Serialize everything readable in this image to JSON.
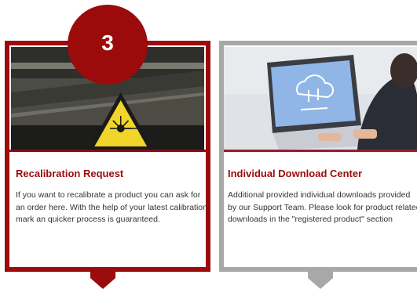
{
  "cards": [
    {
      "badge": "3",
      "title": "Recalibration Request",
      "description": "If you want to recalibrate a product you can ask for an order here. With the help of your latest calibration mark an quicker process is guaranteed."
    },
    {
      "title": "Individual Download Center",
      "description": "Additional provided individual downloads provided by our Support Team. Please look for product related downloads in the \"registered product\" section"
    }
  ],
  "colors": {
    "accent": "#9b0b0b",
    "inactive_border": "#a8a8a8"
  }
}
